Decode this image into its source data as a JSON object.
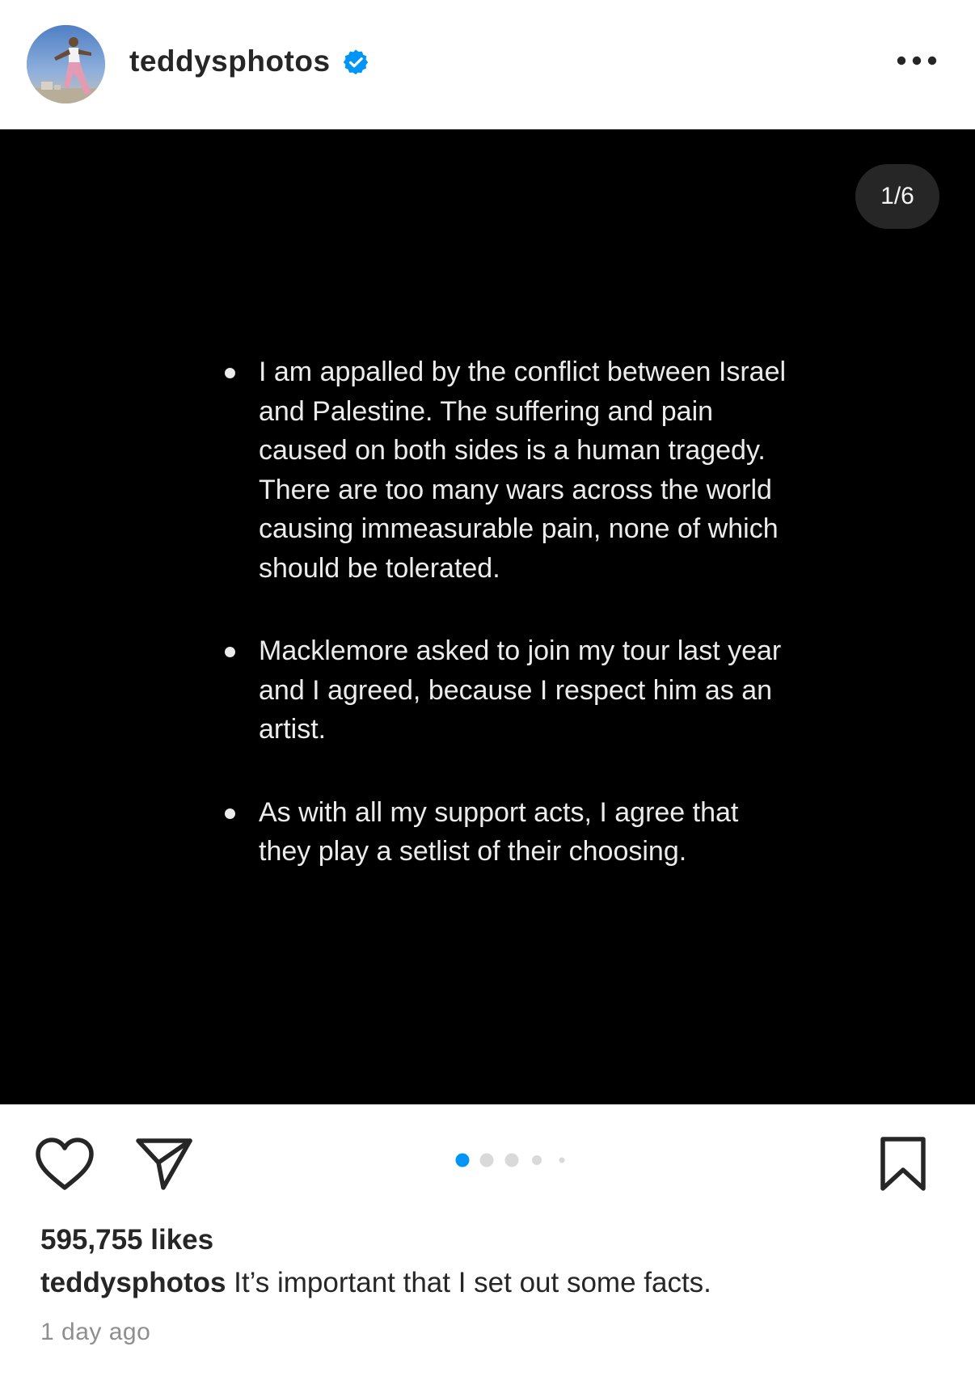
{
  "header": {
    "username": "teddysphotos",
    "verified": true,
    "more_icon": "ellipsis-icon"
  },
  "post": {
    "counter": "1/6",
    "background_color": "#000000",
    "bullets": [
      "I am appalled by the conflict between Israel and Palestine. The suffering and pain caused on both sides is a human tragedy. There are too many wars across the world causing immeasurable pain, none of which should be tolerated.",
      "Macklemore asked to join my tour last year and I agreed, because I respect him as an artist.",
      "As with all my support acts, I agree that they play a setlist of their choosing."
    ]
  },
  "actions": {
    "like_icon": "heart-icon",
    "share_icon": "paper-plane-icon",
    "save_icon": "bookmark-icon",
    "carousel": {
      "total": 6,
      "current": 1,
      "active_color": "#0095f6"
    }
  },
  "meta": {
    "likes": "595,755 likes",
    "caption_user": "teddysphotos",
    "caption_text": " It’s important that I set out some facts.",
    "timestamp": "1 day ago"
  },
  "colors": {
    "verified_badge": "#0095f6",
    "text_primary": "#262626",
    "text_secondary": "#8e8e8e"
  }
}
